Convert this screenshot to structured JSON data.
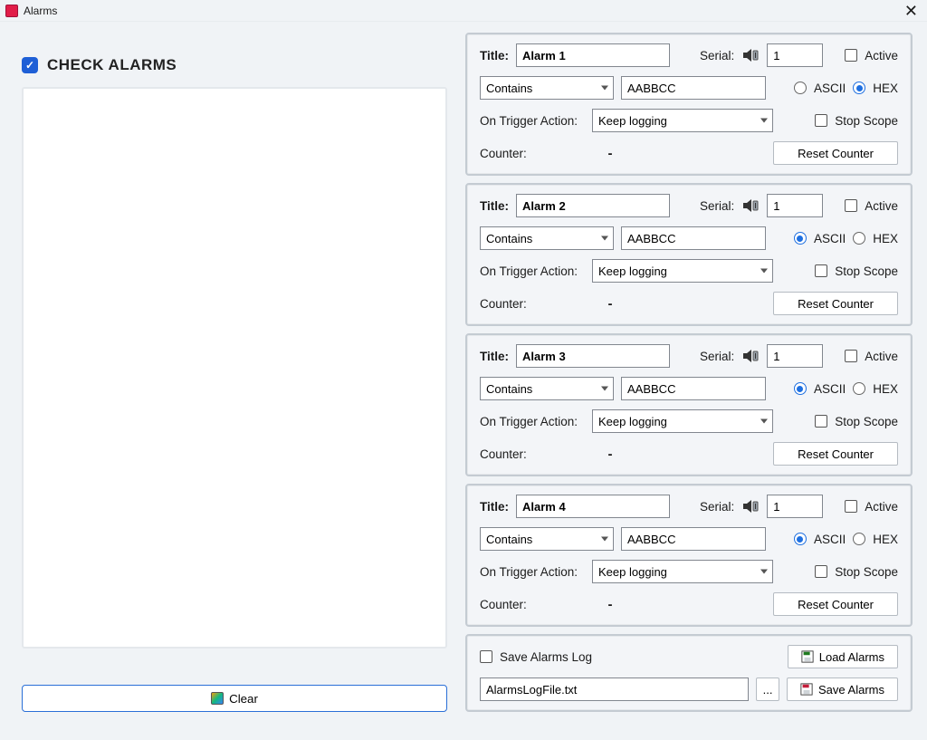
{
  "window": {
    "title": "Alarms"
  },
  "checkAlarms": {
    "checked": true,
    "label": "CHECK ALARMS"
  },
  "clearButton": "Clear",
  "alarms": [
    {
      "titleLabel": "Title:",
      "title": "Alarm 1",
      "serialLabel": "Serial:",
      "serial": "1",
      "activeLabel": "Active",
      "containsLabel": "Contains",
      "pattern": "AABBCC",
      "asciiLabel": "ASCII",
      "hexLabel": "HEX",
      "encodingSelected": "HEX",
      "triggerLabel": "On Trigger Action:",
      "action": "Keep logging",
      "stopScopeLabel": "Stop Scope",
      "counterLabel": "Counter:",
      "counter": "-",
      "resetLabel": "Reset Counter"
    },
    {
      "titleLabel": "Title:",
      "title": "Alarm 2",
      "serialLabel": "Serial:",
      "serial": "1",
      "activeLabel": "Active",
      "containsLabel": "Contains",
      "pattern": "AABBCC",
      "asciiLabel": "ASCII",
      "hexLabel": "HEX",
      "encodingSelected": "ASCII",
      "triggerLabel": "On Trigger Action:",
      "action": "Keep logging",
      "stopScopeLabel": "Stop Scope",
      "counterLabel": "Counter:",
      "counter": "-",
      "resetLabel": "Reset Counter"
    },
    {
      "titleLabel": "Title:",
      "title": "Alarm 3",
      "serialLabel": "Serial:",
      "serial": "1",
      "activeLabel": "Active",
      "containsLabel": "Contains",
      "pattern": "AABBCC",
      "asciiLabel": "ASCII",
      "hexLabel": "HEX",
      "encodingSelected": "ASCII",
      "triggerLabel": "On Trigger Action:",
      "action": "Keep logging",
      "stopScopeLabel": "Stop Scope",
      "counterLabel": "Counter:",
      "counter": "-",
      "resetLabel": "Reset Counter"
    },
    {
      "titleLabel": "Title:",
      "title": "Alarm 4",
      "serialLabel": "Serial:",
      "serial": "1",
      "activeLabel": "Active",
      "containsLabel": "Contains",
      "pattern": "AABBCC",
      "asciiLabel": "ASCII",
      "hexLabel": "HEX",
      "encodingSelected": "ASCII",
      "triggerLabel": "On Trigger Action:",
      "action": "Keep logging",
      "stopScopeLabel": "Stop Scope",
      "counterLabel": "Counter:",
      "counter": "-",
      "resetLabel": "Reset Counter"
    }
  ],
  "savePanel": {
    "saveLogLabel": "Save Alarms Log",
    "logFile": "AlarmsLogFile.txt",
    "browseLabel": "...",
    "loadLabel": "Load Alarms",
    "saveLabel": "Save Alarms"
  }
}
